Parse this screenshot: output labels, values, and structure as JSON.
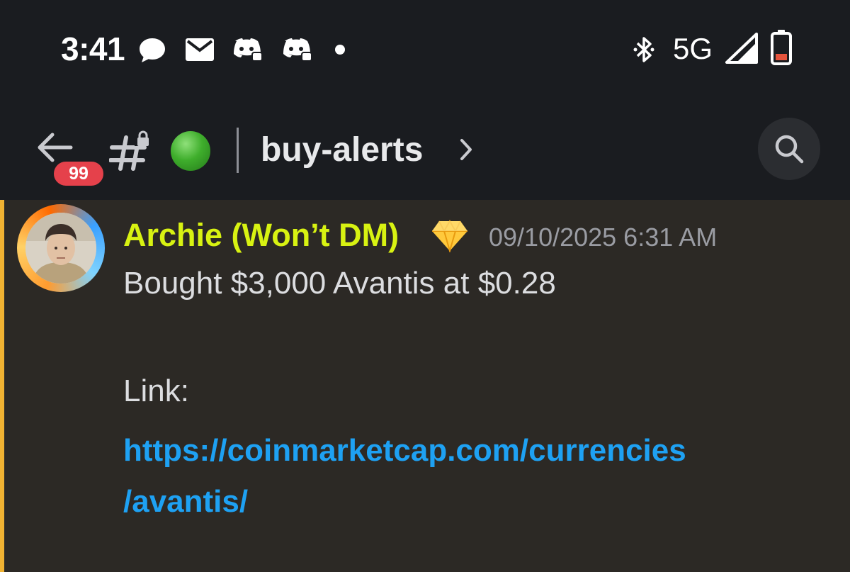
{
  "status_bar": {
    "time": "3:41",
    "network": "5G",
    "icons": [
      "chat-bubble-icon",
      "mail-icon",
      "discord-icon",
      "discord-icon",
      "notification-dot-icon",
      "bluetooth-icon",
      "signal-icon",
      "battery-icon"
    ],
    "battery_color": "#e5533c"
  },
  "header": {
    "unread_badge": "99",
    "channel_name": "buy-alerts",
    "status_emoji": "green-circle-icon",
    "badge_color": "#e5414b"
  },
  "message": {
    "author": "Archie (Won’t DM)",
    "author_color": "#d8f212",
    "author_badge": "gem-icon",
    "timestamp": "09/10/2025 6:31 AM",
    "text": "Bought $3,000 Avantis at $0.28",
    "link_label": "Link:",
    "link_line_1": "https://coinmarketcap.com/currencies",
    "link_line_2": "/avantis/",
    "link_color": "#1ea1f3",
    "highlight_color": "#f0b232"
  }
}
